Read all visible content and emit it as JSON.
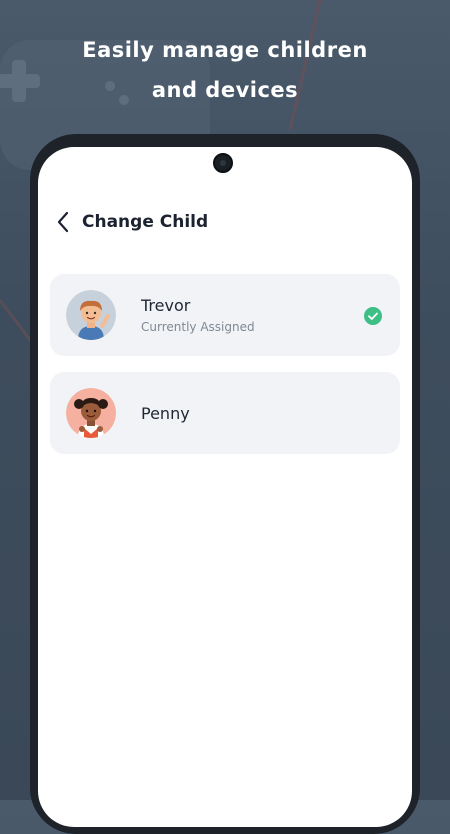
{
  "promo": {
    "line1": "Easily manage children",
    "line2": "and devices"
  },
  "header": {
    "back_icon": "chevron-left-icon",
    "title": "Change Child"
  },
  "children": [
    {
      "name": "Trevor",
      "status": "Currently Assigned",
      "selected": true,
      "avatar_bg": "#c7d1dc",
      "check_color": "#3dbf85"
    },
    {
      "name": "Penny",
      "status": "",
      "selected": false,
      "avatar_bg": "#f6b0a0"
    }
  ],
  "colors": {
    "background": "#3e4d5d",
    "card": "#f1f3f6",
    "accent_check": "#3dbf85",
    "title_text": "#1c2330"
  }
}
